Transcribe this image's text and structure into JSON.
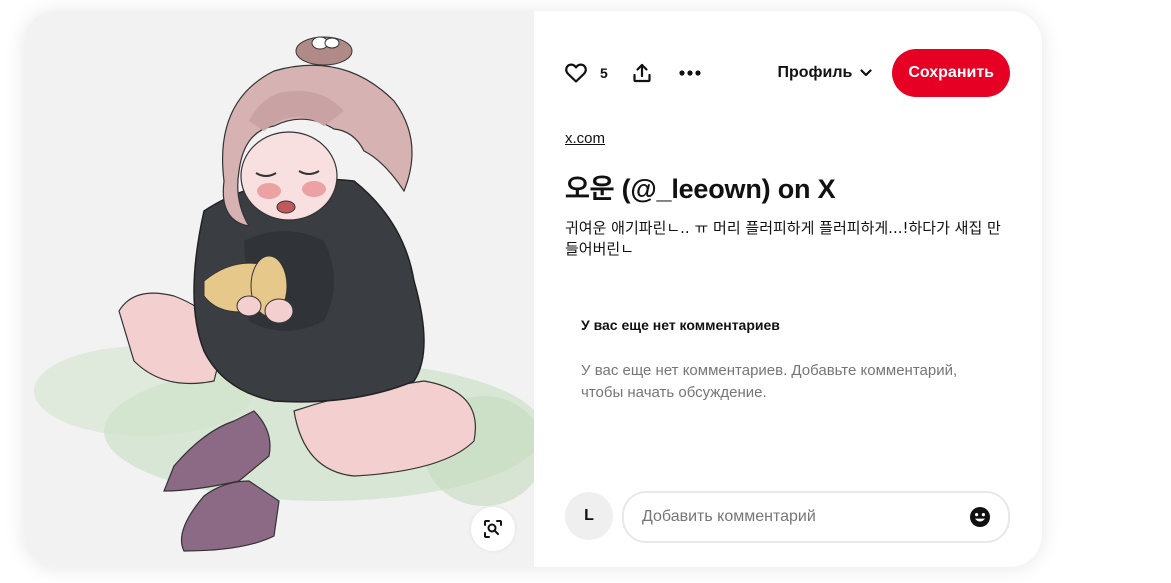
{
  "toolbar": {
    "like_count": "5",
    "profile_label": "Профиль",
    "save_label": "Сохранить"
  },
  "pin": {
    "source": "x.com",
    "title": "오운 (@_leeown) on X",
    "description": "귀여운 애기파린ㄴ.. ㅠ 머리 플러피하게 플러피하게...!하다가 새집 만들어버린ㄴ"
  },
  "comments": {
    "heading": "У вас еще нет комментариев",
    "empty_text": "У вас еще нет комментариев. Добавьте комментарий, чтобы начать обсуждение.",
    "input_placeholder": "Добавить комментарий"
  },
  "user": {
    "avatar_initial": "L"
  },
  "colors": {
    "save_button": "#e60023",
    "image_background": "#f2f2f2",
    "muted_text": "#767676"
  },
  "icons": [
    "heart-icon",
    "share-icon",
    "more-icon",
    "chevron-down-icon",
    "visual-search-icon",
    "emoji-icon"
  ]
}
